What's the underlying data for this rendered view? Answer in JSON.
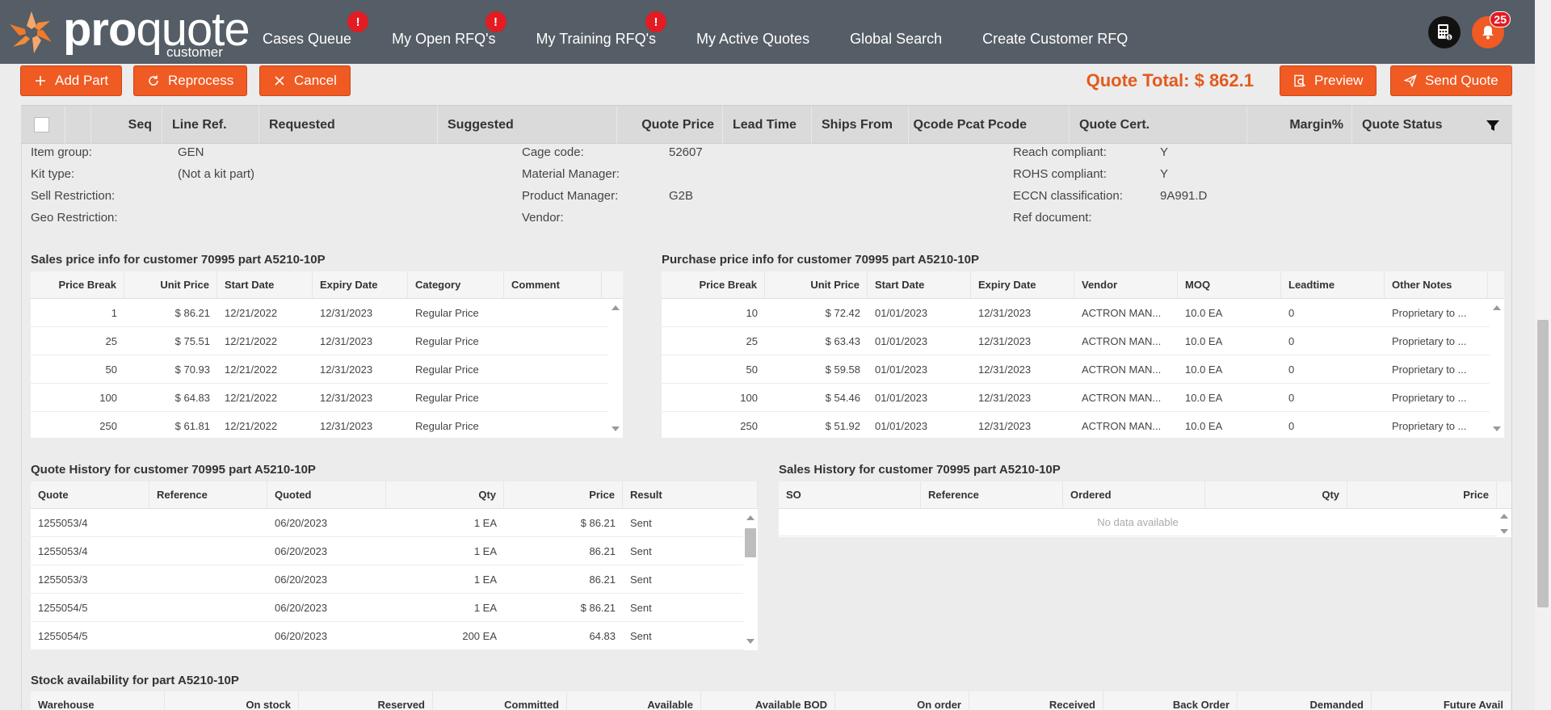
{
  "app": {
    "logo_pro": "pro",
    "logo_quote": "quote",
    "logo_sub": "customer"
  },
  "nav": [
    {
      "label": "Cases Queue",
      "badge": "!"
    },
    {
      "label": "My Open RFQ's",
      "badge": "!"
    },
    {
      "label": "My Training RFQ's",
      "badge": "!"
    },
    {
      "label": "My Active Quotes",
      "badge": ""
    },
    {
      "label": "Global Search",
      "badge": ""
    },
    {
      "label": "Create Customer RFQ",
      "badge": ""
    }
  ],
  "notifications": {
    "count": "25"
  },
  "icons": {
    "calculator": "calculator-icon",
    "bell": "bell-icon",
    "filter": "filter-icon",
    "accent": "#f05a23",
    "badge": "#e31b23"
  },
  "toolbar": {
    "add_part": "Add Part",
    "reprocess": "Reprocess",
    "cancel": "Cancel",
    "quote_total": "Quote Total: $ 862.1",
    "preview": "Preview",
    "send_quote": "Send Quote"
  },
  "grid_columns": [
    "Seq",
    "Line Ref.",
    "Requested",
    "Suggested",
    "Quote Price",
    "Lead Time",
    "Ships From",
    "Qcode Pcat Pcode",
    "Quote Cert.",
    "Margin%",
    "Quote Status"
  ],
  "attributes": {
    "col1": [
      {
        "label": "Item group",
        "value": "GEN"
      },
      {
        "label": "Kit type",
        "value": "(Not a kit part)"
      },
      {
        "label": "Sell Restriction",
        "value": ""
      },
      {
        "label": "Geo Restriction",
        "value": ""
      }
    ],
    "col2": [
      {
        "label": "Cage code",
        "value": "52607"
      },
      {
        "label": "Material Manager",
        "value": ""
      },
      {
        "label": "Product Manager",
        "value": "G2B"
      },
      {
        "label": "Vendor",
        "value": ""
      }
    ],
    "col3": [
      {
        "label": "Reach compliant",
        "value": "Y"
      },
      {
        "label": "ROHS compliant",
        "value": "Y"
      },
      {
        "label": "ECCN classification",
        "value": "9A991.D"
      },
      {
        "label": "Ref document",
        "value": ""
      }
    ]
  },
  "sales_price": {
    "title": "Sales price info for customer 70995 part A5210-10P",
    "columns": [
      "Price Break",
      "Unit Price",
      "Start Date",
      "Expiry Date",
      "Category",
      "Comment"
    ],
    "rows": [
      [
        "1",
        "$ 86.21",
        "12/21/2022",
        "12/31/2023",
        "Regular Price",
        ""
      ],
      [
        "25",
        "$ 75.51",
        "12/21/2022",
        "12/31/2023",
        "Regular Price",
        ""
      ],
      [
        "50",
        "$ 70.93",
        "12/21/2022",
        "12/31/2023",
        "Regular Price",
        ""
      ],
      [
        "100",
        "$ 64.83",
        "12/21/2022",
        "12/31/2023",
        "Regular Price",
        ""
      ],
      [
        "250",
        "$ 61.81",
        "12/21/2022",
        "12/31/2023",
        "Regular Price",
        ""
      ]
    ]
  },
  "purchase_price": {
    "title": "Purchase price info for customer 70995 part A5210-10P",
    "columns": [
      "Price Break",
      "Unit Price",
      "Start Date",
      "Expiry Date",
      "Vendor",
      "MOQ",
      "Leadtime",
      "Other Notes"
    ],
    "rows": [
      [
        "10",
        "$ 72.42",
        "01/01/2023",
        "12/31/2023",
        "ACTRON MAN...",
        "10.0 EA",
        "0",
        "Proprietary to ..."
      ],
      [
        "25",
        "$ 63.43",
        "01/01/2023",
        "12/31/2023",
        "ACTRON MAN...",
        "10.0 EA",
        "0",
        "Proprietary to ..."
      ],
      [
        "50",
        "$ 59.58",
        "01/01/2023",
        "12/31/2023",
        "ACTRON MAN...",
        "10.0 EA",
        "0",
        "Proprietary to ..."
      ],
      [
        "100",
        "$ 54.46",
        "01/01/2023",
        "12/31/2023",
        "ACTRON MAN...",
        "10.0 EA",
        "0",
        "Proprietary to ..."
      ],
      [
        "250",
        "$ 51.92",
        "01/01/2023",
        "12/31/2023",
        "ACTRON MAN...",
        "10.0 EA",
        "0",
        "Proprietary to ..."
      ]
    ]
  },
  "quote_history": {
    "title": "Quote History for customer 70995 part A5210-10P",
    "columns": [
      "Quote",
      "Reference",
      "Quoted",
      "Qty",
      "Price",
      "Result"
    ],
    "rows": [
      [
        "1255053/4",
        "",
        "06/20/2023",
        "1 EA",
        "$ 86.21",
        "Sent"
      ],
      [
        "1255053/4",
        "",
        "06/20/2023",
        "1 EA",
        "86.21",
        "Sent"
      ],
      [
        "1255053/3",
        "",
        "06/20/2023",
        "1 EA",
        "86.21",
        "Sent"
      ],
      [
        "1255054/5",
        "",
        "06/20/2023",
        "1 EA",
        "$ 86.21",
        "Sent"
      ],
      [
        "1255054/5",
        "",
        "06/20/2023",
        "200 EA",
        "64.83",
        "Sent"
      ]
    ]
  },
  "sales_history": {
    "title": "Sales History for customer 70995 part A5210-10P",
    "columns": [
      "SO",
      "Reference",
      "Ordered",
      "Qty",
      "Price"
    ],
    "empty": "No data available"
  },
  "stock": {
    "title": "Stock availability for part A5210-10P",
    "columns": [
      "Warehouse",
      "On stock",
      "Reserved",
      "Committed",
      "Available",
      "Available BOD",
      "On order",
      "Received",
      "Back Order",
      "Demanded",
      "Future Avail"
    ]
  }
}
